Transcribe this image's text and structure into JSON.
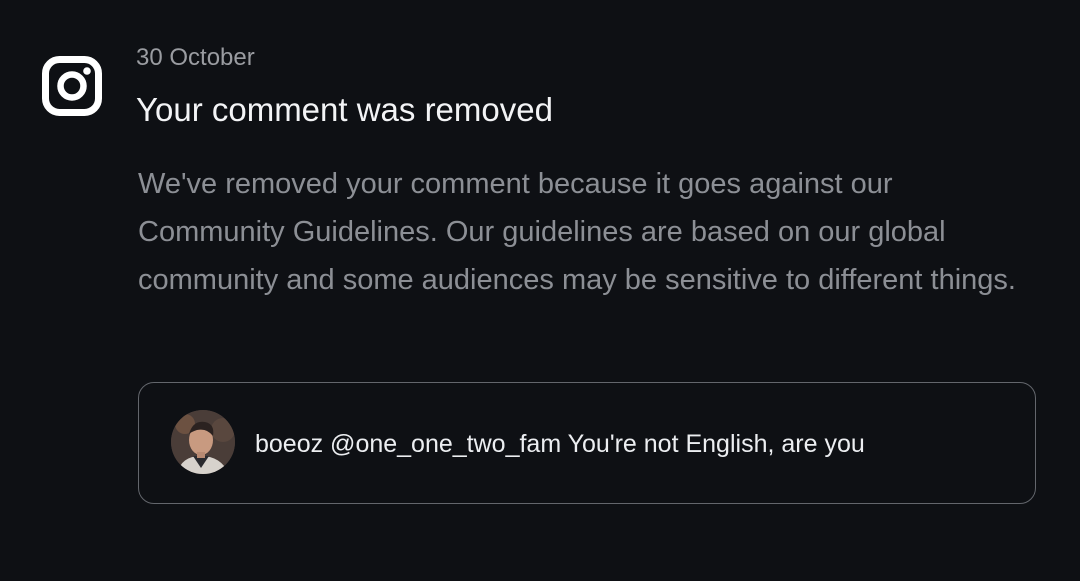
{
  "app": {
    "icon": "instagram-icon"
  },
  "notification": {
    "date": "30 October",
    "title": "Your comment was removed",
    "body": "We've removed your comment because it goes against our Community Guidelines. Our guidelines are based on our global community and some audiences may be sensitive to different things."
  },
  "comment": {
    "avatar_icon": "user-avatar",
    "text": "boeoz @one_one_two_fam You're not English, are you"
  },
  "colors": {
    "background": "#0e1014",
    "title": "#f3f4f6",
    "body": "#8c8f95",
    "date": "#9a9ca1",
    "card_border": "#63666c"
  }
}
